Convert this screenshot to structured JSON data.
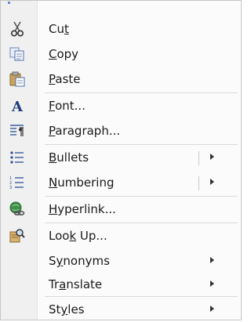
{
  "menu": {
    "items": [
      {
        "pre": "Cu",
        "u": "t",
        "post": "",
        "icon": "scissors-icon"
      },
      {
        "pre": "",
        "u": "C",
        "post": "opy",
        "icon": "copy-icon"
      },
      {
        "pre": "",
        "u": "P",
        "post": "aste",
        "icon": "paste-icon"
      },
      {
        "pre": "",
        "u": "F",
        "post": "ont...",
        "icon": "font-icon"
      },
      {
        "pre": "",
        "u": "P",
        "post": "aragraph...",
        "icon": "paragraph-icon"
      },
      {
        "pre": "",
        "u": "B",
        "post": "ullets",
        "icon": "bullets-icon"
      },
      {
        "pre": "",
        "u": "N",
        "post": "umbering",
        "icon": "numbering-icon"
      },
      {
        "pre": "",
        "u": "H",
        "post": "yperlink...",
        "icon": "hyperlink-icon"
      },
      {
        "pre": "Loo",
        "u": "k",
        "post": " Up...",
        "icon": "research-icon"
      },
      {
        "pre": "S",
        "u": "y",
        "post": "nonyms",
        "icon": ""
      },
      {
        "pre": "Tr",
        "u": "a",
        "post": "nslate",
        "icon": ""
      },
      {
        "pre": "St",
        "u": "y",
        "post": "les",
        "icon": ""
      }
    ]
  }
}
